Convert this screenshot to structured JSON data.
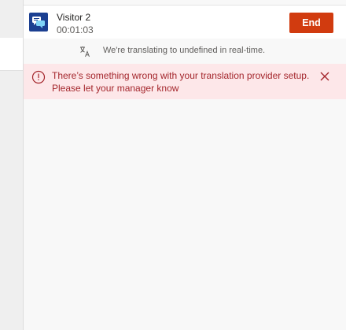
{
  "session": {
    "visitor_name": "Visitor 2",
    "timer": "00:01:03",
    "end_button_label": "End",
    "avatar_icon": "chat-bubbles-icon"
  },
  "translation": {
    "icon": "translate-icon",
    "status_text": "We're translating to undefined in real-time."
  },
  "error": {
    "icon": "error-circle-icon",
    "message": "There’s something wrong with your translation provider setup. Please let your manager know",
    "close_icon": "close-icon"
  },
  "colors": {
    "accent_end": "#d13b0f",
    "avatar_bg": "#1b3f91",
    "error_bg": "#fde7e9",
    "error_text": "#a4262c"
  }
}
